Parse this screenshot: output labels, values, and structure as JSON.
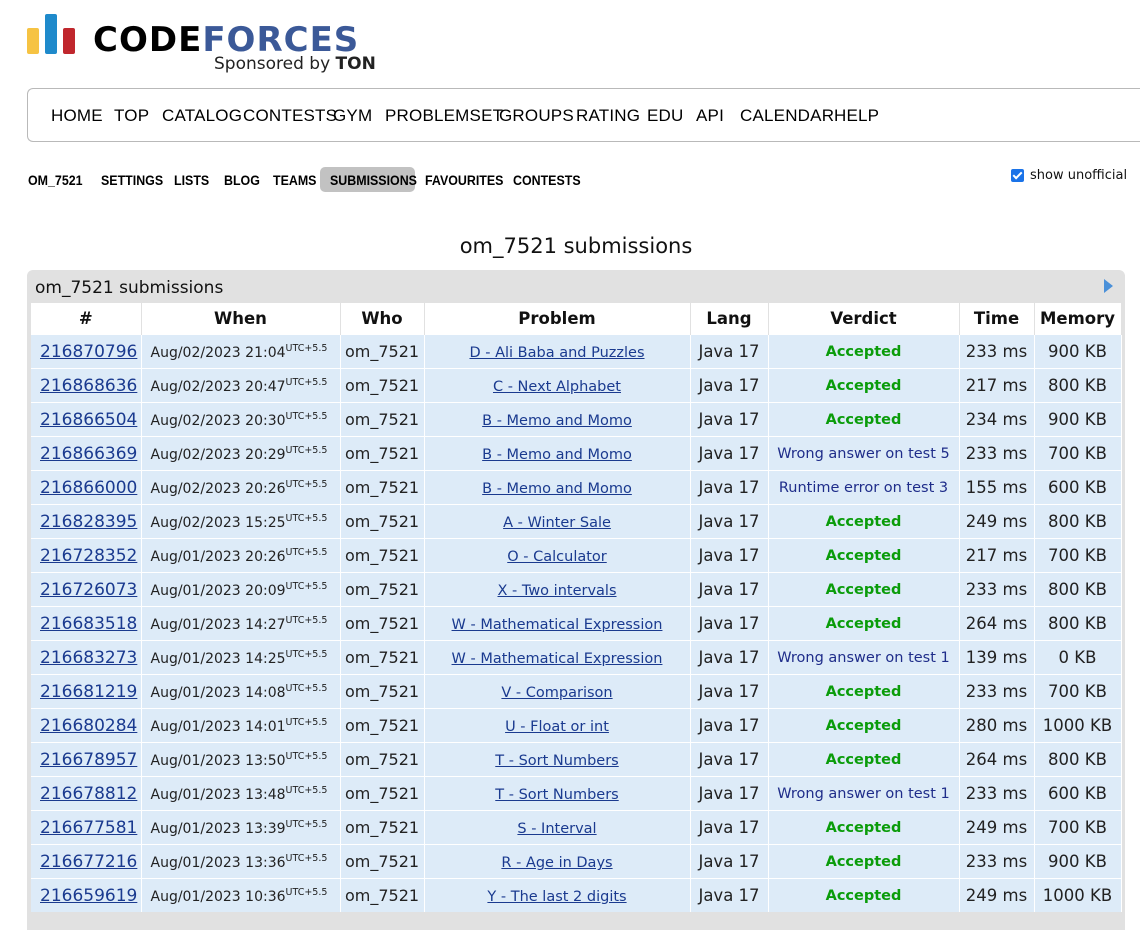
{
  "brand": {
    "code": "CODE",
    "forces": "FORCES",
    "sponsored": "Sponsored by",
    "sponsor_name": "TON"
  },
  "main_menu": [
    "HOME",
    "TOP",
    "CATALOG",
    "CONTESTS",
    "GYM",
    "PROBLEMSET",
    "GROUPS",
    "RATING",
    "EDU",
    "API",
    "CALENDAR",
    "HELP"
  ],
  "sub_menu": [
    "OM_7521",
    "SETTINGS",
    "LISTS",
    "BLOG",
    "TEAMS",
    "SUBMISSIONS",
    "FAVOURITES",
    "CONTESTS"
  ],
  "active_sub_menu": "SUBMISSIONS",
  "show_unofficial": {
    "label": "show unofficial",
    "checked": true
  },
  "page_title": "om_7521 submissions",
  "table_title": "om_7521 submissions",
  "columns": [
    "#",
    "When",
    "Who",
    "Problem",
    "Lang",
    "Verdict",
    "Time",
    "Memory"
  ],
  "tz": "UTC+5.5",
  "rows": [
    {
      "id": "216870796",
      "when": "Aug/02/2023 21:04",
      "who": "om_7521",
      "problem": "D - Ali Baba and Puzzles",
      "lang": "Java 17",
      "verdict": "Accepted",
      "time": "233 ms",
      "memory": "900 KB"
    },
    {
      "id": "216868636",
      "when": "Aug/02/2023 20:47",
      "who": "om_7521",
      "problem": "C - Next Alphabet",
      "lang": "Java 17",
      "verdict": "Accepted",
      "time": "217 ms",
      "memory": "800 KB"
    },
    {
      "id": "216866504",
      "when": "Aug/02/2023 20:30",
      "who": "om_7521",
      "problem": "B - Memo and Momo",
      "lang": "Java 17",
      "verdict": "Accepted",
      "time": "234 ms",
      "memory": "900 KB"
    },
    {
      "id": "216866369",
      "when": "Aug/02/2023 20:29",
      "who": "om_7521",
      "problem": "B - Memo and Momo",
      "lang": "Java 17",
      "verdict": "Wrong answer on test 5",
      "time": "233 ms",
      "memory": "700 KB"
    },
    {
      "id": "216866000",
      "when": "Aug/02/2023 20:26",
      "who": "om_7521",
      "problem": "B - Memo and Momo",
      "lang": "Java 17",
      "verdict": "Runtime error on test 3",
      "time": "155 ms",
      "memory": "600 KB"
    },
    {
      "id": "216828395",
      "when": "Aug/02/2023 15:25",
      "who": "om_7521",
      "problem": "A - Winter Sale",
      "lang": "Java 17",
      "verdict": "Accepted",
      "time": "249 ms",
      "memory": "800 KB"
    },
    {
      "id": "216728352",
      "when": "Aug/01/2023 20:26",
      "who": "om_7521",
      "problem": "O - Calculator",
      "lang": "Java 17",
      "verdict": "Accepted",
      "time": "217 ms",
      "memory": "700 KB"
    },
    {
      "id": "216726073",
      "when": "Aug/01/2023 20:09",
      "who": "om_7521",
      "problem": "X - Two intervals",
      "lang": "Java 17",
      "verdict": "Accepted",
      "time": "233 ms",
      "memory": "800 KB"
    },
    {
      "id": "216683518",
      "when": "Aug/01/2023 14:27",
      "who": "om_7521",
      "problem": "W - Mathematical Expression",
      "lang": "Java 17",
      "verdict": "Accepted",
      "time": "264 ms",
      "memory": "800 KB"
    },
    {
      "id": "216683273",
      "when": "Aug/01/2023 14:25",
      "who": "om_7521",
      "problem": "W - Mathematical Expression",
      "lang": "Java 17",
      "verdict": "Wrong answer on test 1",
      "time": "139 ms",
      "memory": "0 KB"
    },
    {
      "id": "216681219",
      "when": "Aug/01/2023 14:08",
      "who": "om_7521",
      "problem": "V - Comparison",
      "lang": "Java 17",
      "verdict": "Accepted",
      "time": "233 ms",
      "memory": "700 KB"
    },
    {
      "id": "216680284",
      "when": "Aug/01/2023 14:01",
      "who": "om_7521",
      "problem": "U - Float or int",
      "lang": "Java 17",
      "verdict": "Accepted",
      "time": "280 ms",
      "memory": "1000 KB"
    },
    {
      "id": "216678957",
      "when": "Aug/01/2023 13:50",
      "who": "om_7521",
      "problem": "T - Sort Numbers",
      "lang": "Java 17",
      "verdict": "Accepted",
      "time": "264 ms",
      "memory": "800 KB"
    },
    {
      "id": "216678812",
      "when": "Aug/01/2023 13:48",
      "who": "om_7521",
      "problem": "T - Sort Numbers",
      "lang": "Java 17",
      "verdict": "Wrong answer on test 1",
      "time": "233 ms",
      "memory": "600 KB"
    },
    {
      "id": "216677581",
      "when": "Aug/01/2023 13:39",
      "who": "om_7521",
      "problem": "S - Interval",
      "lang": "Java 17",
      "verdict": "Accepted",
      "time": "249 ms",
      "memory": "700 KB"
    },
    {
      "id": "216677216",
      "when": "Aug/01/2023 13:36",
      "who": "om_7521",
      "problem": "R - Age in Days",
      "lang": "Java 17",
      "verdict": "Accepted",
      "time": "233 ms",
      "memory": "900 KB"
    },
    {
      "id": "216659619",
      "when": "Aug/01/2023 10:36",
      "who": "om_7521",
      "problem": "Y - The last 2 digits",
      "lang": "Java 17",
      "verdict": "Accepted",
      "time": "249 ms",
      "memory": "1000 KB"
    }
  ]
}
